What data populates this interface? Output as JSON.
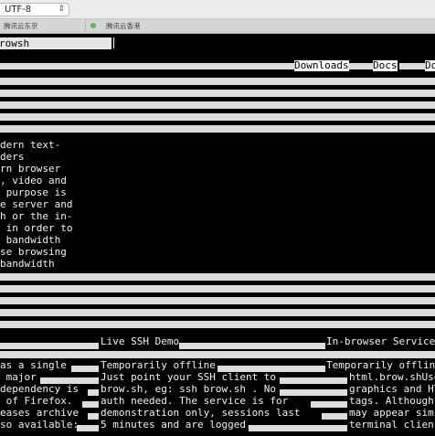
{
  "toolbar": {
    "encoding": "UTF-8"
  },
  "tabs": [
    {
      "label": "腾讯云东京"
    },
    {
      "label": "腾讯云香港"
    }
  ],
  "browser": {
    "url": "rowsh"
  },
  "nav": {
    "downloads": "Downloads",
    "docs": "Docs",
    "other": "Do"
  },
  "intro_lines": [
    "dern text-",
    "ders",
    "rn browser",
    ", video and",
    " purpose is",
    "e server and",
    "h or the in-",
    " in order to",
    " bandwidth",
    "se browsing",
    "bandwidth"
  ],
  "section_headers": {
    "demo": "Live SSH Demo",
    "services": "In-browser Services"
  },
  "columns": {
    "left": [
      "as a single",
      " major",
      "dependency is",
      " of Firefox.",
      "eases archive",
      "so available:"
    ],
    "middle": [
      "Temporarily offline",
      "Just point your SSH client to",
      "brow.sh, eg: ssh brow.sh . No",
      "auth needed. The service is for",
      "demonstration only, sessions last",
      "5 minutes and are logged."
    ],
    "right": [
      "Temporarily offline",
      "html.brow.shUse",
      "graphics and HTM",
      "tags. Although",
      "may appear sim",
      "terminal clien"
    ]
  }
}
